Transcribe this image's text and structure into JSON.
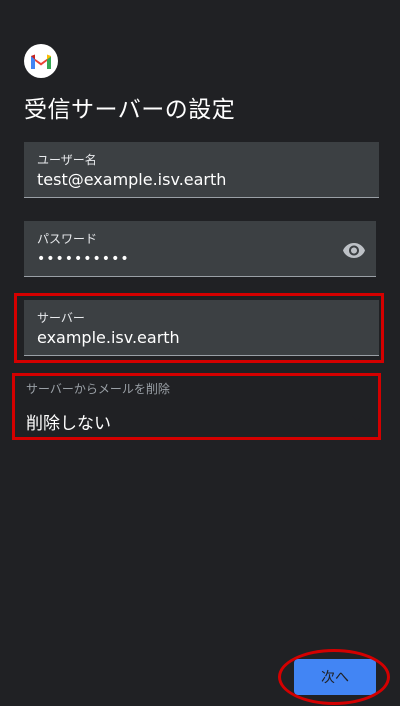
{
  "header": {
    "logo_icon": "gmail-logo-icon",
    "title": "受信サーバーの設定"
  },
  "form": {
    "username": {
      "label": "ユーザー名",
      "value": "test@example.isv.earth"
    },
    "password": {
      "label": "パスワード",
      "value": "••••••••••",
      "toggle_icon": "eye-icon"
    },
    "server": {
      "label": "サーバー",
      "value": "example.isv.earth"
    },
    "delete_policy": {
      "label": "サーバーからメールを削除",
      "selected": "削除しない",
      "caret_icon": "chevron-down-icon"
    }
  },
  "footer": {
    "next_label": "次へ"
  },
  "colors": {
    "background": "#202124",
    "field_bg": "#3c4043",
    "accent": "#4285f4",
    "highlight": "#d40000"
  }
}
